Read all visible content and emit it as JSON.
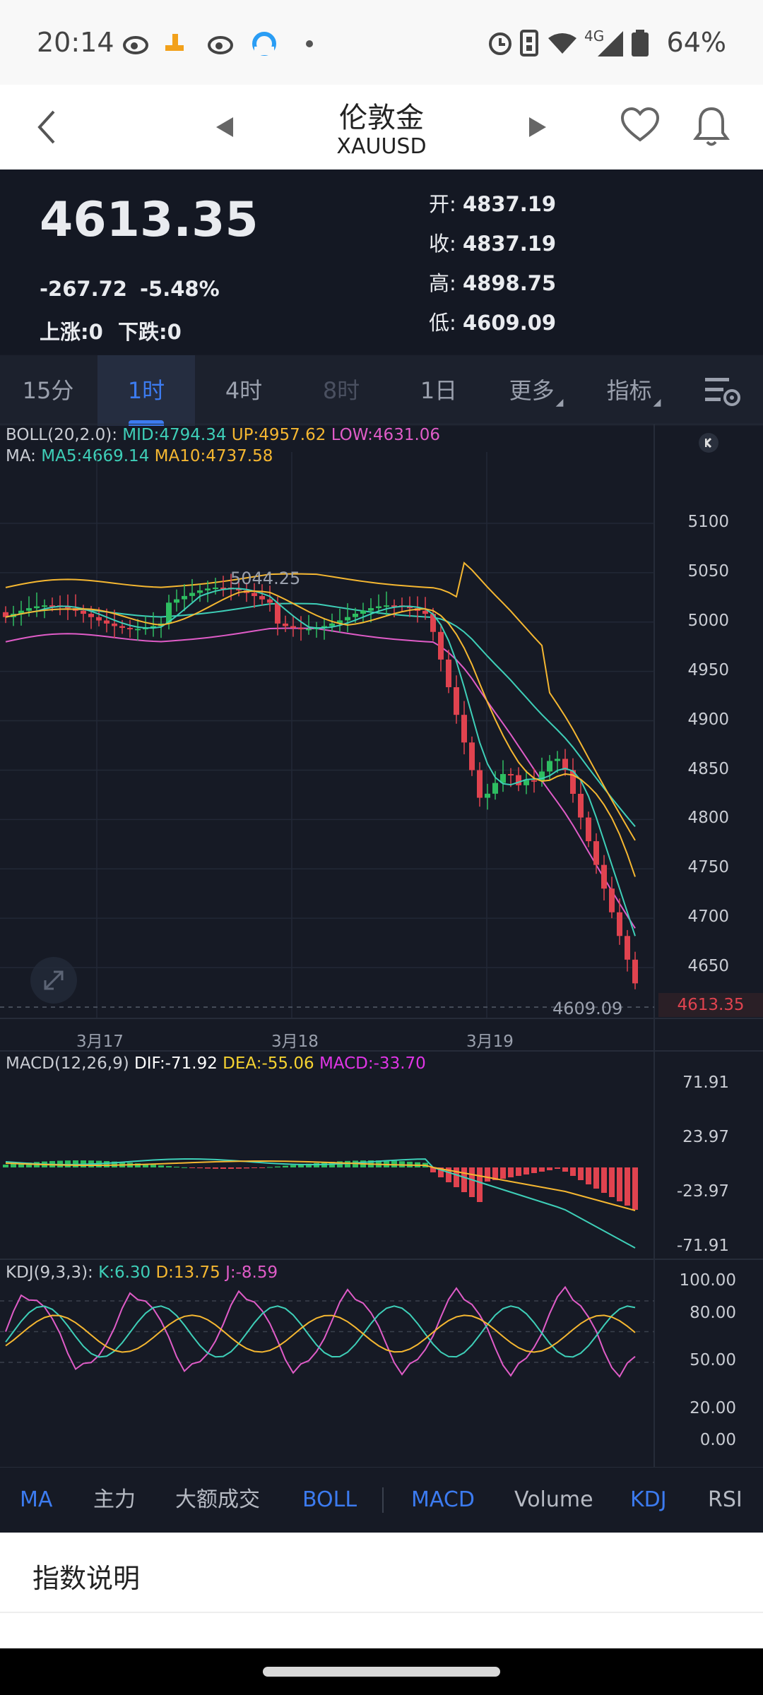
{
  "status_bar": {
    "time": "20:14",
    "network": "4G",
    "battery": "64%"
  },
  "header": {
    "title": "伦敦金",
    "symbol": "XAUUSD"
  },
  "quote": {
    "price": "4613.35",
    "change": "-267.72",
    "change_pct": "-5.48%",
    "up_label": "上涨:0",
    "down_label": "下跌:0",
    "open_label": "开:",
    "open": "4837.19",
    "close_label": "收:",
    "close": "4837.19",
    "high_label": "高:",
    "high": "4898.75",
    "low_label": "低:",
    "low": "4609.09"
  },
  "tabs": [
    "15分",
    "1时",
    "4时",
    "8时",
    "1日",
    "更多",
    "指标"
  ],
  "active_tab": "1时",
  "main_chart": {
    "boll_label": "BOLL(20,2.0):",
    "boll_mid": "MID:4794.34",
    "boll_up": "UP:4957.62",
    "boll_low": "LOW:4631.06",
    "ma_label": "MA:",
    "ma5": "MA5:4669.14",
    "ma10": "MA10:4737.58",
    "y_ticks": [
      "5100",
      "5050",
      "5000",
      "4950",
      "4900",
      "4850",
      "4800",
      "4750",
      "4700",
      "4650"
    ],
    "high_marker": "5044.25",
    "low_marker": "4609.09",
    "last_price_tag": "4613.35",
    "x_dates": [
      "3月17",
      "3月18",
      "3月19"
    ]
  },
  "macd_chart": {
    "label": "MACD(12,26,9)",
    "dif": "DIF:-71.92",
    "dea": "DEA:-55.06",
    "macd": "MACD:-33.70",
    "y_ticks": [
      "71.91",
      "23.97",
      "-23.97",
      "-71.91"
    ]
  },
  "kdj_chart": {
    "label": "KDJ(9,3,3):",
    "k": "K:6.30",
    "d": "D:13.75",
    "j": "J:-8.59",
    "y_ticks": [
      "100.00",
      "80.00",
      "50.00",
      "20.00",
      "0.00"
    ]
  },
  "indicators": [
    "MA",
    "主力",
    "大额成交",
    "BOLL",
    "MACD",
    "Volume",
    "KDJ",
    "RSI"
  ],
  "indicators_on": [
    "MA",
    "BOLL",
    "MACD",
    "KDJ"
  ],
  "info_section": {
    "heading": "指数说明"
  },
  "colors": {
    "background": "#161a25",
    "accent_blue": "#3c7bf0",
    "up_green": "#2ebd61",
    "down_red": "#e0434f",
    "ma5_cyan": "#3ecfb8",
    "ma10_yellow": "#f5b731",
    "boll_mid": "#3ecfb8",
    "boll_up": "#f5b731",
    "boll_low": "#e05cc8",
    "dif": "#ffffff",
    "dea": "#f5d231",
    "macd": "#e035e6"
  }
}
